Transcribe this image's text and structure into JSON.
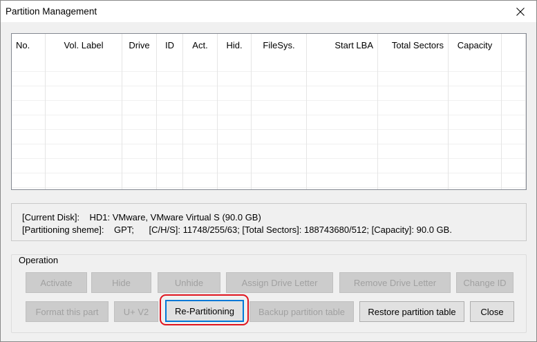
{
  "window": {
    "title": "Partition Management"
  },
  "table": {
    "columns": [
      "No.",
      "Vol. Label",
      "Drive",
      "ID",
      "Act.",
      "Hid.",
      "FileSys.",
      "Start LBA",
      "Total Sectors",
      "Capacity"
    ],
    "empty_rows": 11
  },
  "info": {
    "line1": "[Current Disk]:    HD1: VMware, VMware Virtual S (90.0 GB)",
    "line2": "[Partitioning sheme]:    GPT;      [C/H/S]: 11748/255/63; [Total Sectors]: 188743680/512; [Capacity]: 90.0 GB."
  },
  "operation": {
    "label": "Operation",
    "buttons": {
      "activate": "Activate",
      "hide": "Hide",
      "unhide": "Unhide",
      "assign_drive_letter": "Assign Drive Letter",
      "remove_drive_letter": "Remove Drive Letter",
      "change_id": "Change ID",
      "format_this_part": "Format this part",
      "u_v2": "U+ V2",
      "re_partitioning": "Re-Partitioning",
      "backup_partition_table": "Backup partition table",
      "restore_partition_table": "Restore partition table",
      "close": "Close"
    }
  },
  "colors": {
    "focus_border": "#0078d7",
    "annotation_highlight": "#e0141e"
  }
}
